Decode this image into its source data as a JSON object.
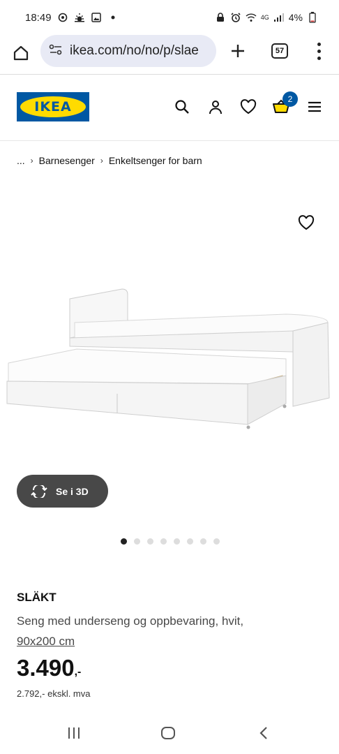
{
  "status_bar": {
    "time": "18:49",
    "network": "4G",
    "battery": "4%"
  },
  "browser": {
    "url": "ikea.com/no/no/p/slae",
    "tab_count": "57"
  },
  "header": {
    "logo_text": "IKEA",
    "cart_count": "2",
    "brand_colors": {
      "blue": "#0058a3",
      "yellow": "#ffdb00"
    }
  },
  "breadcrumb": {
    "items": [
      "...",
      "Barnesenger",
      "Enkeltsenger for barn"
    ]
  },
  "gallery": {
    "view_3d_label": "Se i 3D",
    "dot_count": 8,
    "active_dot": 0
  },
  "product": {
    "name": "SLÄKT",
    "description": "Seng med underseng og oppbevaring, hvit,",
    "size": "90x200 cm",
    "price": "3.490",
    "price_suffix": ",-",
    "price_ex_vat": "2.792,- ekskl. mva"
  }
}
